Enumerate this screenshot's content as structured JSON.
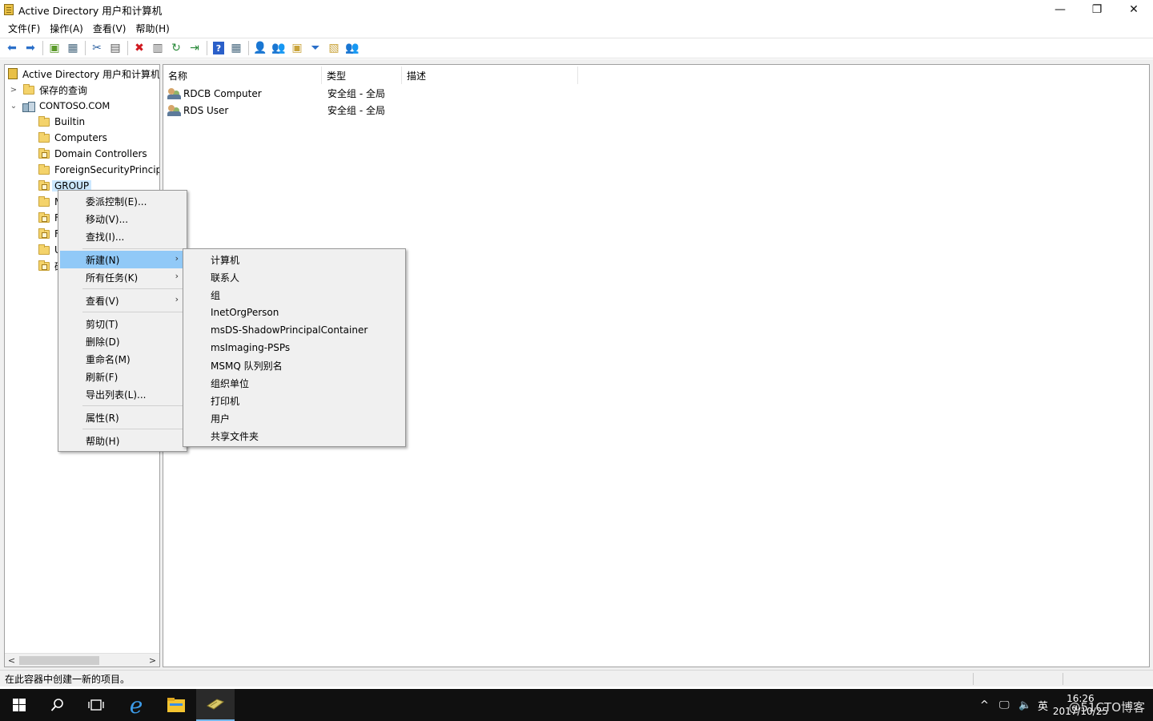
{
  "window": {
    "title": "Active Directory 用户和计算机",
    "minimize": "—",
    "restore": "❐",
    "close": "✕"
  },
  "menubar": [
    "文件(F)",
    "操作(A)",
    "查看(V)",
    "帮助(H)"
  ],
  "toolbar": {
    "icons": [
      "back-icon",
      "forward-icon",
      "up-folder-icon",
      "show-hide-tree-icon",
      "cut-icon",
      "copy-icon",
      "delete-icon",
      "properties-icon",
      "refresh-icon",
      "export-icon",
      "help-icon",
      "console-tree-icon",
      "new-user-icon",
      "new-group-icon",
      "new-ou-icon",
      "filter-icon",
      "find-icon",
      "add-to-group-icon"
    ]
  },
  "tree": {
    "root": "Active Directory 用户和计算机",
    "saved_queries": "保存的查询",
    "domain": "CONTOSO.COM",
    "items": [
      {
        "label": "Builtin",
        "type": "folder"
      },
      {
        "label": "Computers",
        "type": "folder"
      },
      {
        "label": "Domain Controllers",
        "type": "ou"
      },
      {
        "label": "ForeignSecurityPrincipa",
        "type": "folder"
      },
      {
        "label": "GROUP",
        "type": "ou",
        "selected": true
      },
      {
        "label": "M",
        "type": "folder"
      },
      {
        "label": "F",
        "type": "ou"
      },
      {
        "label": "F",
        "type": "ou"
      },
      {
        "label": "U",
        "type": "folder"
      },
      {
        "label": "研",
        "type": "ou"
      }
    ]
  },
  "list": {
    "columns": [
      "名称",
      "类型",
      "描述"
    ],
    "rows": [
      {
        "name": "RDCB Computer",
        "type": "安全组 - 全局",
        "desc": ""
      },
      {
        "name": "RDS User",
        "type": "安全组 - 全局",
        "desc": ""
      }
    ]
  },
  "context_menu": {
    "items": [
      {
        "label": "委派控制(E)...",
        "submenu": false
      },
      {
        "label": "移动(V)...",
        "submenu": false
      },
      {
        "label": "查找(I)...",
        "submenu": false
      },
      {
        "label": "新建(N)",
        "submenu": true,
        "highlight": true
      },
      {
        "label": "所有任务(K)",
        "submenu": true
      },
      {
        "label": "查看(V)",
        "submenu": true
      },
      {
        "label": "剪切(T)",
        "submenu": false
      },
      {
        "label": "删除(D)",
        "submenu": false
      },
      {
        "label": "重命名(M)",
        "submenu": false
      },
      {
        "label": "刷新(F)",
        "submenu": false
      },
      {
        "label": "导出列表(L)...",
        "submenu": false
      },
      {
        "label": "属性(R)",
        "submenu": false
      },
      {
        "label": "帮助(H)",
        "submenu": false
      }
    ]
  },
  "new_submenu": {
    "items": [
      "计算机",
      "联系人",
      "组",
      "InetOrgPerson",
      "msDS-ShadowPrincipalContainer",
      "msImaging-PSPs",
      "MSMQ 队列别名",
      "组织单位",
      "打印机",
      "用户",
      "共享文件夹"
    ]
  },
  "statusbar": {
    "text": "在此容器中创建一新的项目。"
  },
  "taskbar": {
    "icons": [
      "start-icon",
      "search-icon",
      "task-view-icon",
      "ie-icon",
      "file-explorer-icon",
      "aduc-icon"
    ],
    "tray": {
      "chevron": "^",
      "network": "🖵",
      "volume": "🔈",
      "ime": "英",
      "time": "16:26",
      "date": "2017/10/25",
      "watermark": "@51CTO博客"
    }
  },
  "colors": {
    "selection": "#cce8ff",
    "menu_highlight": "#91c9f7",
    "taskbar": "#101010"
  }
}
